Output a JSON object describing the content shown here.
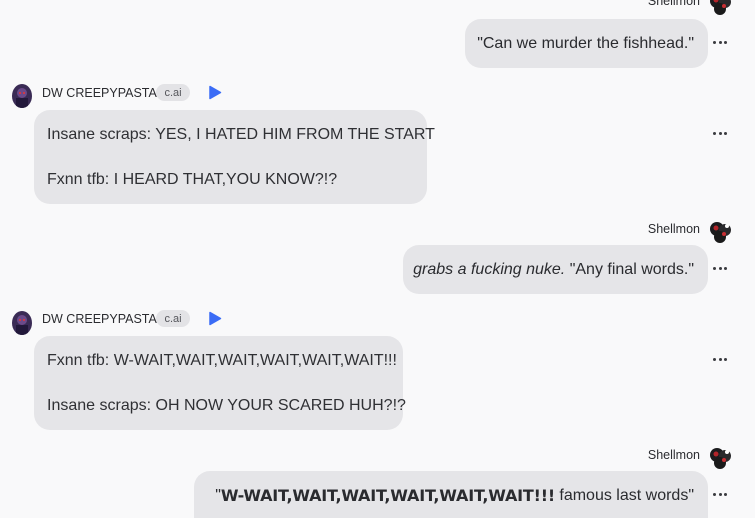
{
  "messages": [
    {
      "role": "user",
      "name": "Shellmon",
      "text": "\"Can we murder the fishhead.\""
    },
    {
      "role": "bot",
      "name": "DW CREEPYPASTA",
      "badge": "c.ai",
      "lines": [
        "Insane scraps: YES, I HATED HIM FROM THE START",
        "Fxnn tfb: I HEARD THAT,YOU KNOW?!?"
      ]
    },
    {
      "role": "user",
      "name": "Shellmon",
      "italic": "grabs a fucking nuke.",
      "text": " \"Any final words.\""
    },
    {
      "role": "bot",
      "name": "DW CREEPYPASTA",
      "badge": "c.ai",
      "lines": [
        "Fxnn tfb: W-WAIT,WAIT,WAIT,WAIT,WAIT,WAIT!!!",
        "Insane scraps: OH NOW YOUR SCARED HUH?!?"
      ]
    },
    {
      "role": "user",
      "name": "Shellmon",
      "quote_open": "\"",
      "bold": "W-WAIT,WAIT,WAIT,WAIT,WAIT,WAIT!!!",
      "text": " famous last words\""
    }
  ],
  "icons": {
    "user_avatar": "black-white-creature-avatar-icon",
    "bot_avatar": "purple-character-avatar-icon",
    "play": "play-icon",
    "more": "more-options-icon"
  },
  "colors": {
    "accent": "#3b6cf6",
    "bubble": "#e5e5e8",
    "background": "#f9f9fa"
  }
}
